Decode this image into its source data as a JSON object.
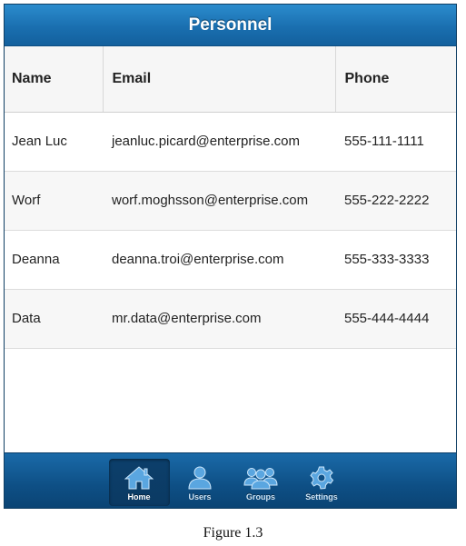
{
  "header": {
    "title": "Personnel"
  },
  "table": {
    "columns": [
      "Name",
      "Email",
      "Phone"
    ],
    "rows": [
      {
        "name": "Jean Luc",
        "email": "jeanluc.picard@enterprise.com",
        "phone": "555-111-1111"
      },
      {
        "name": "Worf",
        "email": "worf.moghsson@enterprise.com",
        "phone": "555-222-2222"
      },
      {
        "name": "Deanna",
        "email": "deanna.troi@enterprise.com",
        "phone": "555-333-3333"
      },
      {
        "name": "Data",
        "email": "mr.data@enterprise.com",
        "phone": "555-444-4444"
      }
    ]
  },
  "tabbar": {
    "tabs": [
      {
        "label": "Home",
        "icon": "home-icon",
        "active": true
      },
      {
        "label": "Users",
        "icon": "user-icon",
        "active": false
      },
      {
        "label": "Groups",
        "icon": "group-icon",
        "active": false
      },
      {
        "label": "Settings",
        "icon": "gear-icon",
        "active": false
      }
    ]
  },
  "caption": "Figure 1.3",
  "colors": {
    "header": "#1a6fb0",
    "tabbar": "#0e4f85",
    "icon": "#5aa6e0"
  }
}
